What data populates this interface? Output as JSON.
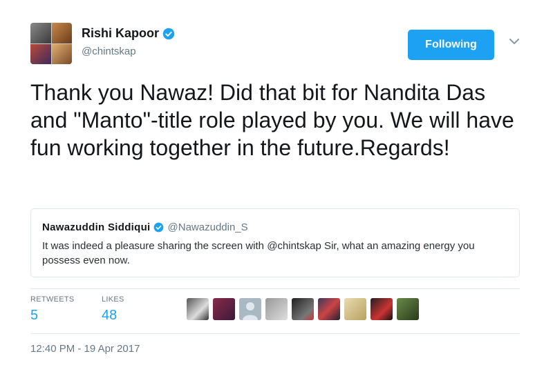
{
  "author": {
    "name": "Rishi Kapoor",
    "handle": "@chintskap",
    "verified": true
  },
  "follow_button": {
    "label": "Following"
  },
  "tweet": {
    "text": "Thank you Nawaz! Did that bit for Nandita Das and \"Manto\"-title role played by you. We will have fun working together in the future.Regards!"
  },
  "quoted_tweet": {
    "name": "Nawazuddin Siddiqui",
    "handle": "@Nawazuddin_S",
    "verified": true,
    "text": "It was indeed a pleasure sharing the screen with @chintskap Sir, what an amazing energy you possess even now."
  },
  "stats": {
    "retweets_label": "RETWEETS",
    "retweets_value": "5",
    "likes_label": "LIKES",
    "likes_value": "48"
  },
  "timestamp": "12:40 PM - 19 Apr 2017",
  "colors": {
    "accent": "#1da1f2",
    "secondary_text": "#657786",
    "border": "#e1e8ed"
  }
}
